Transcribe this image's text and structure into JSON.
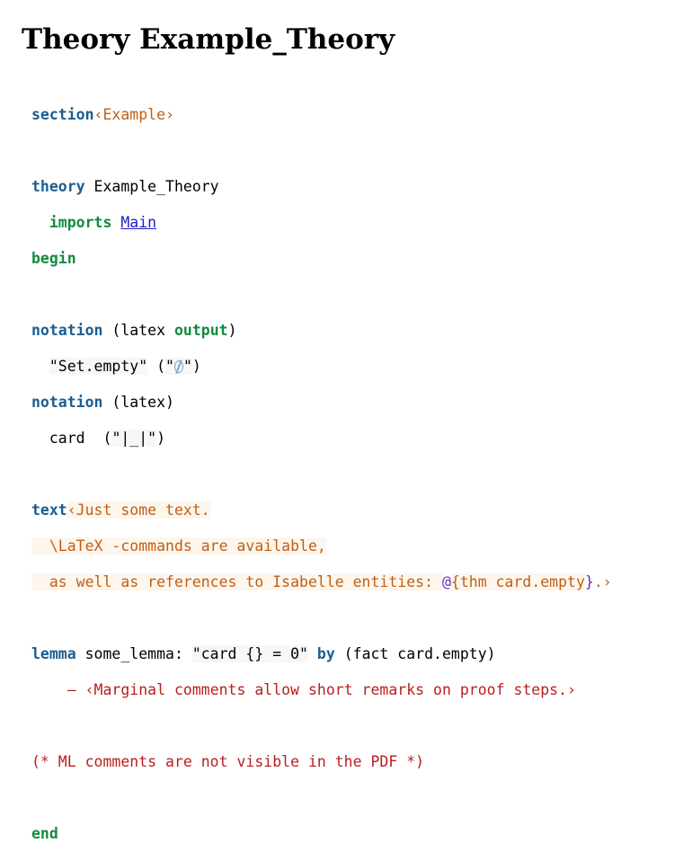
{
  "page": {
    "title": "Theory Example_Theory"
  },
  "code": {
    "section_kw": "section",
    "section_open": "‹",
    "section_text": "Example",
    "section_close": "›",
    "theory_kw": "theory",
    "theory_name": " Example_Theory",
    "imports_indent": "  ",
    "imports_kw": "imports",
    "imports_sep": " ",
    "imports_target": "Main",
    "begin_kw": "begin",
    "notation1_kw": "notation",
    "notation1_open": " (latex ",
    "notation1_output": "output",
    "notation1_close": ")",
    "notation1_line2_indent": "  ",
    "notation1_str1": "\"Set.empty\"",
    "notation1_mid": " (",
    "notation1_str2_open": "\"",
    "notation1_symbol": "∅",
    "notation1_str2_close": "\"",
    "notation1_end": ")",
    "notation2_kw": "notation",
    "notation2_rest": " (latex)",
    "notation2_line2_indent": "  ",
    "notation2_name": "card",
    "notation2_mid": "  (",
    "notation2_str": "\"|_|\"",
    "notation2_end": ")",
    "text_kw": "text",
    "text_line1": "‹Just some text.",
    "text_line2": "  \\LaTeX -commands are available,",
    "text_line3_a": "  as well as references to Isabelle entities: ",
    "text_line3_at": "@",
    "text_line3_brace_open": "{",
    "text_line3_thm": "thm card.empty",
    "text_line3_brace_close": "}",
    "text_line3_end": ".›",
    "lemma_kw": "lemma",
    "lemma_name": " some_lemma: ",
    "lemma_prop": "\"card {} = 0\"",
    "lemma_sep": " ",
    "by_kw": "by",
    "lemma_method": " (fact card.empty)",
    "marginal_indent": "    ",
    "marginal_text": "— ‹Marginal comments allow short remarks on proof steps.›",
    "ml_comment": "(* ML comments are not visible in the PDF *)",
    "end_kw": "end"
  },
  "colors": {
    "keyword_blue": "#1a5d93",
    "keyword_green": "#138a3c",
    "cartouche_orange": "#c25f14",
    "comment_red": "#b81e1e",
    "antiquote_purple": "#6a2fb0",
    "link_blue": "#1d1dc8"
  }
}
